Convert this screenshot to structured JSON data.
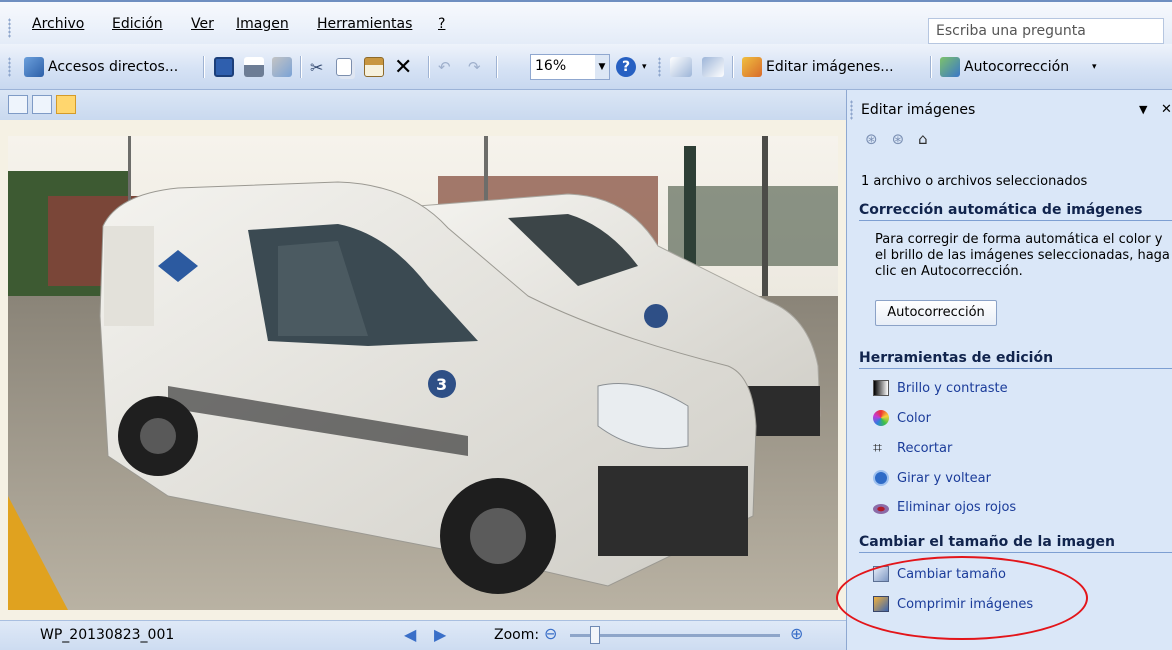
{
  "menu": {
    "archivo": "Archivo",
    "edicion": "Edición",
    "ver": "Ver",
    "imagen": "Imagen",
    "herramientas": "Herramientas",
    "ayuda": "?"
  },
  "ask": {
    "placeholder": "Escriba una pregunta"
  },
  "toolbar": {
    "shortcuts": "Accesos directos...",
    "zoom_value": "16%",
    "edit_images": "Editar imágenes...",
    "autocorrect": "Autocorrección"
  },
  "status": {
    "filename": "WP_20130823_001",
    "zoom_label": "Zoom:",
    "zoom_fraction": 0.1
  },
  "taskpane": {
    "title": "Editar imágenes",
    "selected_info": "1 archivo o archivos seleccionados",
    "section_auto": "Corrección automática de imágenes",
    "auto_desc": "Para corregir de forma automática el color y el brillo de las imágenes seleccionadas, haga clic en Autocorrección.",
    "auto_button": "Autocorrección",
    "section_tools": "Herramientas de edición",
    "tools": [
      "Brillo y contraste",
      "Color",
      "Recortar",
      "Girar y voltear",
      "Eliminar ojos rojos"
    ],
    "section_resize": "Cambiar el tamaño de la imagen",
    "resize": [
      "Cambiar tamaño",
      "Comprimir imágenes"
    ]
  },
  "colors": {
    "link": "#1b3c9a",
    "annotation": "#e3151a",
    "pane": "#dae7f8"
  }
}
